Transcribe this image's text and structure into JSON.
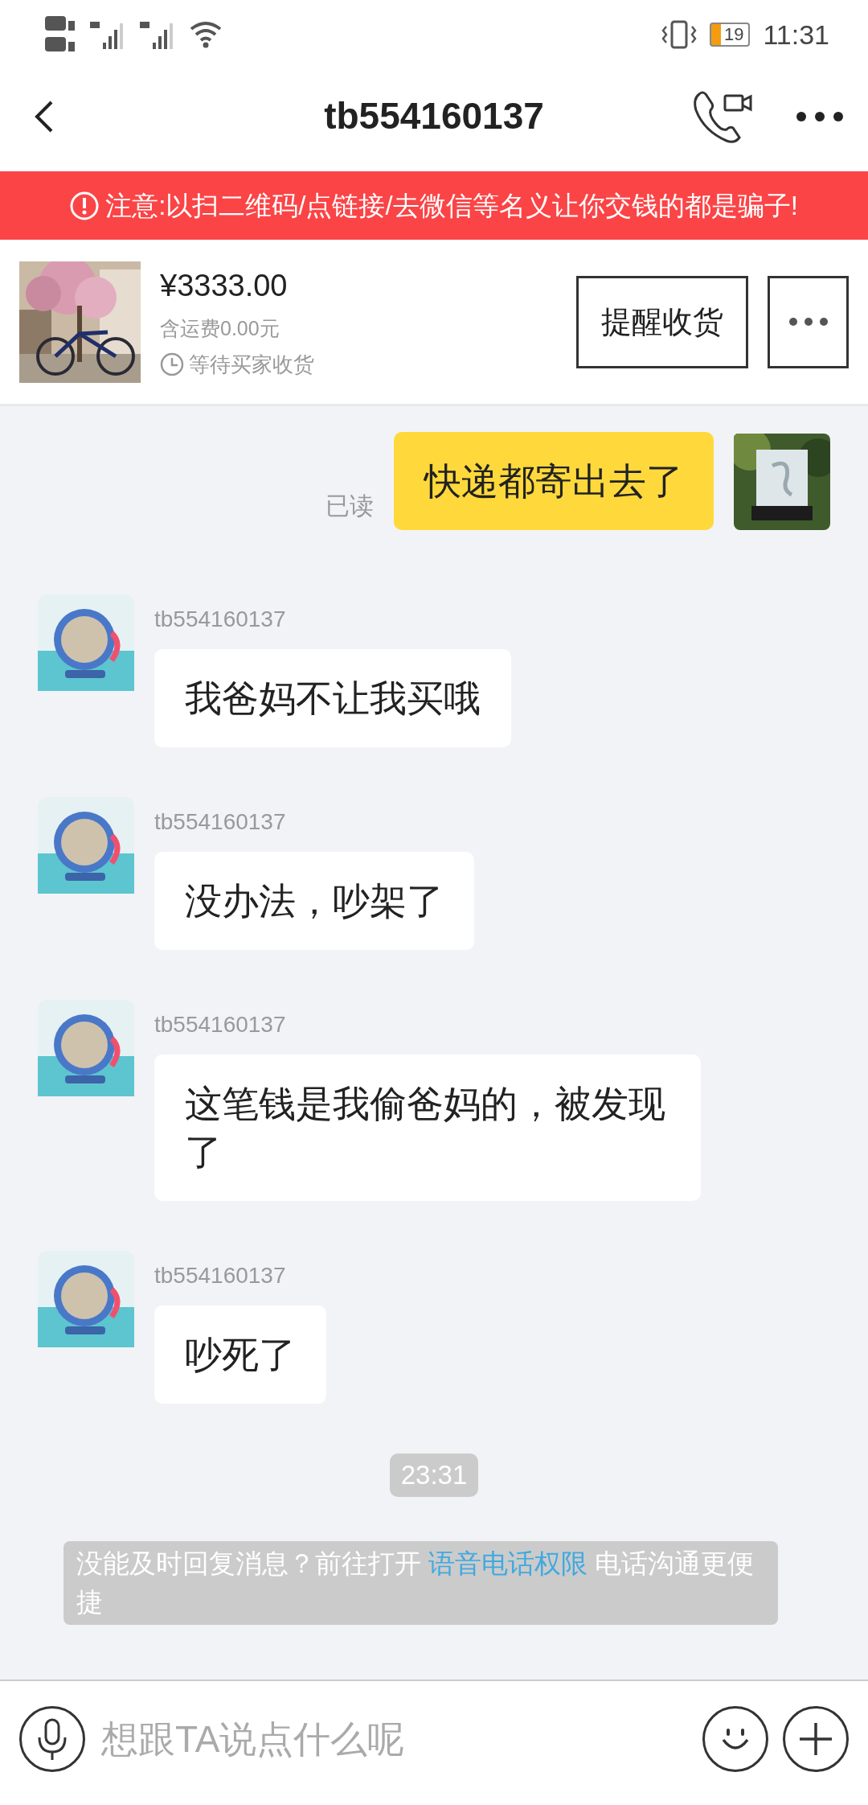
{
  "status_bar": {
    "battery": "19",
    "time": "11:31"
  },
  "header": {
    "title": "tb554160137"
  },
  "warning": "注意:以扫二维码/点链接/去微信等名义让你交钱的都是骗子!",
  "order": {
    "price": "¥3333.00",
    "shipping": "含运费0.00元",
    "status": "等待买家收货",
    "action": "提醒收货"
  },
  "messages": [
    {
      "kind": "sent",
      "text": "快递都寄出去了",
      "receipt": "已读"
    },
    {
      "kind": "received",
      "sender": "tb554160137",
      "text": "我爸妈不让我买哦"
    },
    {
      "kind": "received",
      "sender": "tb554160137",
      "text": "没办法，吵架了"
    },
    {
      "kind": "received",
      "sender": "tb554160137",
      "text": "这笔钱是我偷爸妈的，被发现了"
    },
    {
      "kind": "received",
      "sender": "tb554160137",
      "text": "吵死了"
    }
  ],
  "timestamp": "23:31",
  "notice": {
    "before": "没能及时回复消息？前往打开",
    "link": "语音电话权限",
    "after": "电话沟通更便捷"
  },
  "input": {
    "placeholder": "想跟TA说点什么呢"
  }
}
